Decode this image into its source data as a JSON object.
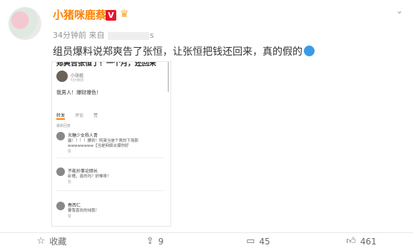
{
  "post": {
    "user_name": "小猪咪鹿蔡",
    "verified_badge": "V",
    "time": "34分钟前",
    "source_prefix": "来自",
    "source_suffix": "s",
    "text": "组员爆料说郑爽告了张恒，让张恒把钱还回来，真的假的",
    "more_icon": "chevron-down-icon"
  },
  "screenshot": {
    "title": "郑爽告张恒了！一个月，还回来",
    "poster_name": "小张姐",
    "poster_time": "5分钟前",
    "text": "我男人！爆财爆色！",
    "tabs": [
      "转发",
      "评论",
      "赞"
    ],
    "section_label": "最新回复",
    "comments": [
      {
        "name": "炎糖少女杨人青",
        "line1": "赢！！！！嫖到！阿爽当是个男的下场那",
        "line2": "wwwwwwww【当是网络炎爆你好",
        "meta": "赞"
      },
      {
        "name": "不能抄事论暗长",
        "line1": "卧槽，真的吗？好棒呀！",
        "line2": "",
        "meta": "赞"
      },
      {
        "name": "春西仁",
        "line1": "要我喜欢的炖我！",
        "line2": "",
        "meta": "赞"
      }
    ]
  },
  "actions": {
    "favorite_label": "收藏",
    "repost_count": "9",
    "comment_count": "45",
    "like_count": "461"
  }
}
